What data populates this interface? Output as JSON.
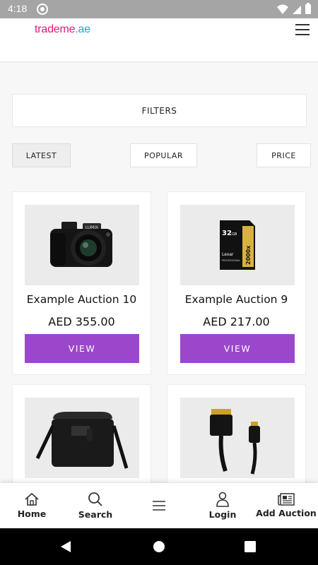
{
  "status_bar": {
    "time": "4:18"
  },
  "header": {
    "logo_part1": "trademe",
    "logo_part2": ".ae"
  },
  "filters": {
    "label": "FILTERS"
  },
  "sort": {
    "latest": "LATEST",
    "popular": "POPULAR",
    "price": "PRICE"
  },
  "listings": [
    {
      "title": "Example Auction 10",
      "price": "AED 355.00",
      "button": "VIEW"
    },
    {
      "title": "Example Auction 9",
      "price": "AED 217.00",
      "button": "VIEW"
    },
    {
      "title": "",
      "price": "",
      "button": ""
    },
    {
      "title": "",
      "price": "",
      "button": ""
    }
  ],
  "product_images": {
    "sd_card_capacity": "32",
    "sd_card_unit": "GB",
    "sd_card_brand": "Lexar",
    "sd_card_line": "PROFESSIONAL",
    "sd_card_speed": "2000x",
    "camera_brand": "LUMIX"
  },
  "bottom_nav": {
    "home": "Home",
    "search": "Search",
    "login": "Login",
    "add_auction": "Add Auction"
  },
  "colors": {
    "accent": "#9b47cc",
    "logo_pink": "#e2177d",
    "logo_blue": "#1da3db"
  }
}
